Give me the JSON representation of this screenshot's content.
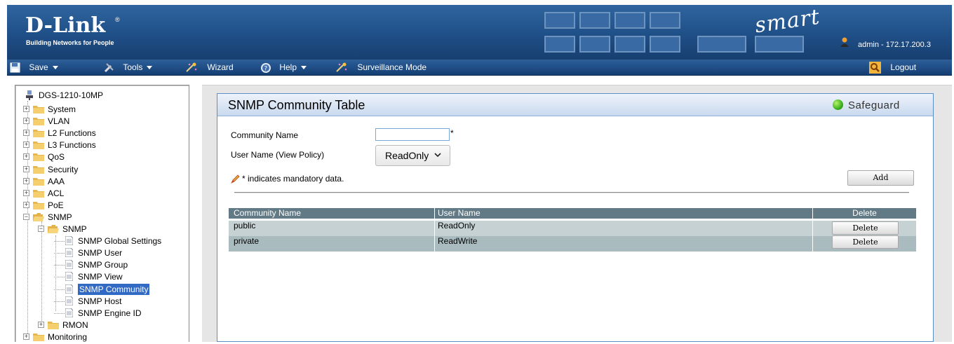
{
  "banner": {
    "logo_main": "D-Link",
    "logo_reg": "®",
    "logo_sub": "Building Networks for People",
    "smart_logo": "smart",
    "user_info": "admin - 172.17.200.3"
  },
  "menu": {
    "save": "Save",
    "tools": "Tools",
    "wizard": "Wizard",
    "help": "Help",
    "surveillance": "Surveillance Mode",
    "logout": "Logout"
  },
  "tree": {
    "root": "DGS-1210-10MP",
    "items": [
      "System",
      "VLAN",
      "L2 Functions",
      "L3 Functions",
      "QoS",
      "Security",
      "AAA",
      "ACL",
      "PoE",
      "SNMP"
    ],
    "snmp_sub": "SNMP",
    "snmp_leaves": [
      "SNMP Global Settings",
      "SNMP User",
      "SNMP Group",
      "SNMP View",
      "SNMP Community",
      "SNMP Host",
      "SNMP Engine ID"
    ],
    "rmon": "RMON",
    "monitoring": "Monitoring"
  },
  "panel": {
    "title": "SNMP Community Table",
    "safeguard": "Safeguard",
    "community_name_label": "Community Name",
    "community_name_value": "",
    "required_mark": "*",
    "user_name_label": "User Name (View Policy)",
    "user_name_selected": "ReadOnly",
    "mandatory_note": "* indicates mandatory data.",
    "add_button": "Add"
  },
  "table": {
    "headers": [
      "Community Name",
      "User Name",
      "Delete"
    ],
    "rows": [
      {
        "community": "public",
        "user": "ReadOnly",
        "delete": "Delete"
      },
      {
        "community": "private",
        "user": "ReadWrite",
        "delete": "Delete"
      }
    ]
  },
  "colors": {
    "banner_blue": "#1f4f87",
    "table_header": "#627a85",
    "row_odd": "#c5d1d2",
    "row_even": "#a9bbbf",
    "selected_tree": "#316ac5",
    "safeguard_green": "#3bb01b"
  }
}
